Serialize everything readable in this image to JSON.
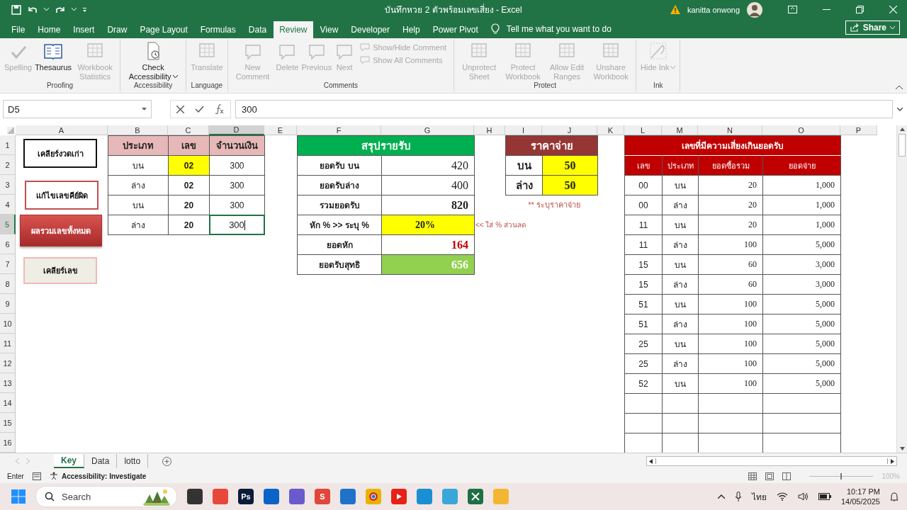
{
  "window": {
    "title": "บันทึกหวย 2 ตัวพร้อมเลขเสี่ยง  -  Excel",
    "user": "kanitta onwong"
  },
  "tabs": [
    {
      "label": "File",
      "selected": false
    },
    {
      "label": "Home",
      "selected": false
    },
    {
      "label": "Insert",
      "selected": false
    },
    {
      "label": "Draw",
      "selected": false
    },
    {
      "label": "Page Layout",
      "selected": false
    },
    {
      "label": "Formulas",
      "selected": false
    },
    {
      "label": "Data",
      "selected": false
    },
    {
      "label": "Review",
      "selected": true
    },
    {
      "label": "View",
      "selected": false
    },
    {
      "label": "Developer",
      "selected": false
    },
    {
      "label": "Help",
      "selected": false
    },
    {
      "label": "Power Pivot",
      "selected": false
    }
  ],
  "tell_me": "Tell me what you want to do",
  "share": "Share",
  "ribbon": [
    {
      "label": "Proofing",
      "buttons": [
        {
          "label": "Spelling",
          "disabled": true,
          "kind": "large"
        },
        {
          "label": "Thesaurus",
          "disabled": false,
          "kind": "large"
        },
        {
          "label": "Workbook Statistics",
          "disabled": true,
          "kind": "large"
        }
      ]
    },
    {
      "label": "Accessibility",
      "buttons": [
        {
          "label": "Check Accessibility",
          "disabled": false,
          "kind": "dropdown"
        }
      ]
    },
    {
      "label": "Language",
      "buttons": [
        {
          "label": "Translate",
          "disabled": true,
          "kind": "large"
        }
      ]
    },
    {
      "label": "Comments",
      "buttons": [
        {
          "label": "New Comment",
          "disabled": true,
          "kind": "large"
        },
        {
          "label": "Delete",
          "disabled": true,
          "kind": "large"
        },
        {
          "label": "Previous",
          "disabled": true,
          "kind": "large"
        },
        {
          "label": "Next",
          "disabled": true,
          "kind": "large"
        },
        {
          "label": "Show/Hide Comment",
          "disabled": true,
          "kind": "small"
        },
        {
          "label": "Show All Comments",
          "disabled": true,
          "kind": "small"
        }
      ]
    },
    {
      "label": "Protect",
      "buttons": [
        {
          "label": "Unprotect Sheet",
          "disabled": true,
          "kind": "large"
        },
        {
          "label": "Protect Workbook",
          "disabled": true,
          "kind": "large"
        },
        {
          "label": "Allow Edit Ranges",
          "disabled": true,
          "kind": "large"
        },
        {
          "label": "Unshare Workbook",
          "disabled": true,
          "kind": "large"
        }
      ]
    },
    {
      "label": "Ink",
      "buttons": [
        {
          "label": "Hide Ink",
          "disabled": true,
          "kind": "dropdown"
        }
      ]
    }
  ],
  "name_box": "D5",
  "formula": "300",
  "columns": [
    {
      "label": "A",
      "selected": false
    },
    {
      "label": "B",
      "selected": false
    },
    {
      "label": "C",
      "selected": false
    },
    {
      "label": "D",
      "selected": true
    },
    {
      "label": "E",
      "selected": false
    },
    {
      "label": "F",
      "selected": false
    },
    {
      "label": "G",
      "selected": false
    },
    {
      "label": "H",
      "selected": false
    },
    {
      "label": "I",
      "selected": false
    },
    {
      "label": "J",
      "selected": false
    },
    {
      "label": "K",
      "selected": false
    },
    {
      "label": "L",
      "selected": false
    },
    {
      "label": "M",
      "selected": false
    },
    {
      "label": "N",
      "selected": false
    },
    {
      "label": "O",
      "selected": false
    },
    {
      "label": "P",
      "selected": false
    }
  ],
  "rows": [
    {
      "label": "1",
      "selected": false
    },
    {
      "label": "2",
      "selected": false
    },
    {
      "label": "3",
      "selected": false
    },
    {
      "label": "4",
      "selected": false
    },
    {
      "label": "5",
      "selected": true
    },
    {
      "label": "6",
      "selected": false
    },
    {
      "label": "7",
      "selected": false
    },
    {
      "label": "8",
      "selected": false
    },
    {
      "label": "9",
      "selected": false
    },
    {
      "label": "10",
      "selected": false
    },
    {
      "label": "11",
      "selected": false
    },
    {
      "label": "12",
      "selected": false
    },
    {
      "label": "13",
      "selected": false
    },
    {
      "label": "14",
      "selected": false
    },
    {
      "label": "15",
      "selected": false
    },
    {
      "label": "16",
      "selected": false
    }
  ],
  "sheet_buttons": [
    {
      "label": "เคลียร์งวดเก่า",
      "kind": "outline"
    },
    {
      "label": "แก้ไขเลขคีย์ผิด",
      "kind": "soft-outline"
    },
    {
      "label": "ผลรวมเลขทั้งหมด",
      "kind": "filled"
    },
    {
      "label": "เคลียร์เลข",
      "kind": "plain"
    }
  ],
  "entry_table": {
    "columns": [
      "ประเภท",
      "เลข",
      "จำนวนเงิน"
    ],
    "rows": [
      {
        "type": "บน",
        "number": "02",
        "amount": "300",
        "highlighted": true,
        "active": false
      },
      {
        "type": "ล่าง",
        "number": "02",
        "amount": "300",
        "highlighted": false,
        "active": false
      },
      {
        "type": "บน",
        "number": "20",
        "amount": "300",
        "highlighted": false,
        "active": false
      },
      {
        "type": "ล่าง",
        "number": "20",
        "amount": "300",
        "highlighted": false,
        "active": true
      }
    ]
  },
  "summary": {
    "title": "สรุปรายรับ",
    "rows": [
      {
        "label": "ยอดรับ บน",
        "value": "420",
        "kind": "plain"
      },
      {
        "label": "ยอดรับล่าง",
        "value": "400",
        "kind": "plain"
      },
      {
        "label": "รวมยอดรับ",
        "value": "820",
        "kind": "total"
      },
      {
        "label": "หัก % >> ระบุ %",
        "value": "20%",
        "kind": "input"
      },
      {
        "label": "ยอดหัก",
        "value": "164",
        "kind": "deduct"
      },
      {
        "label": "ยอดรับสุทธิ",
        "value": "656",
        "kind": "net"
      }
    ],
    "note": "<< ใส่ % ส่วนลด"
  },
  "payout": {
    "title": "ราคาจ่าย",
    "rows": [
      {
        "label": "บน",
        "value": "50"
      },
      {
        "label": "ล่าง",
        "value": "50"
      }
    ],
    "note": "** ระบุราคาจ่าย"
  },
  "risk_table": {
    "title": "เลขที่มีความเสี่ยงเกินยอดรับ",
    "columns": [
      "เลข",
      "ประเภท",
      "ยอดซื้อรวม",
      "ยอดจ่าย"
    ],
    "rows": [
      [
        "00",
        "บน",
        "20",
        "1,000"
      ],
      [
        "00",
        "ล่าง",
        "20",
        "1,000"
      ],
      [
        "11",
        "บน",
        "20",
        "1,000"
      ],
      [
        "11",
        "ล่าง",
        "100",
        "5,000"
      ],
      [
        "15",
        "บน",
        "60",
        "3,000"
      ],
      [
        "15",
        "ล่าง",
        "60",
        "3,000"
      ],
      [
        "51",
        "บน",
        "100",
        "5,000"
      ],
      [
        "51",
        "ล่าง",
        "100",
        "5,000"
      ],
      [
        "25",
        "บน",
        "100",
        "5,000"
      ],
      [
        "25",
        "ล่าง",
        "100",
        "5,000"
      ],
      [
        "52",
        "บน",
        "100",
        "5,000"
      ]
    ]
  },
  "sheet_tabs": [
    {
      "label": "Key",
      "selected": true
    },
    {
      "label": "Data",
      "selected": false
    },
    {
      "label": "lotto",
      "selected": false
    }
  ],
  "status": {
    "mode": "Enter",
    "accessibility": "Accessibility: Investigate",
    "zoom": "100%",
    "zoom_slider": {
      "level": 0.5
    }
  },
  "taskbar": {
    "search": "Search",
    "apps": [
      {
        "kind": "files"
      },
      {
        "kind": "anydesk"
      },
      {
        "kind": "photoshop",
        "label": "Ps"
      },
      {
        "kind": "outlook"
      },
      {
        "kind": "snip"
      },
      {
        "kind": "wps",
        "label": "S"
      },
      {
        "kind": "remote"
      },
      {
        "kind": "chrome"
      },
      {
        "kind": "youtube"
      },
      {
        "kind": "edge"
      },
      {
        "kind": "paint"
      },
      {
        "kind": "excel"
      },
      {
        "kind": "folder"
      }
    ],
    "language": "ไทย",
    "time": "10:17 PM",
    "date": "14/05/2025"
  }
}
